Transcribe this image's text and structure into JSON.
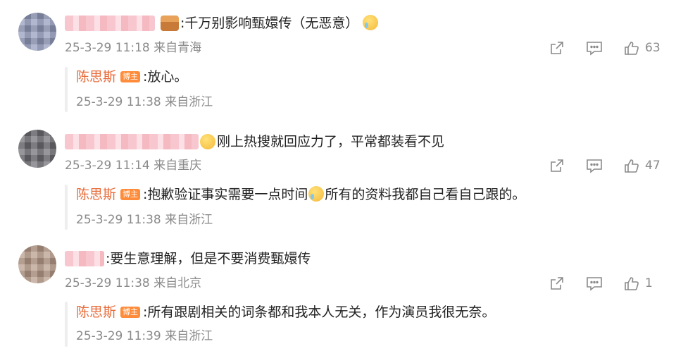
{
  "comments": [
    {
      "text": ":千万别影响甄嬛传（无恶意）",
      "time": "25-3-29 11:18 来自青海",
      "likes": "63",
      "reply": {
        "name": "陈思斯",
        "badge": "博主",
        "text": ":放心。",
        "time": "25-3-29 11:38 来自浙江"
      }
    },
    {
      "text": "刚上热搜就回应力了，平常都装看不见",
      "time": "25-3-29 11:14 来自重庆",
      "likes": "47",
      "reply": {
        "name": "陈思斯",
        "badge": "博主",
        "text_a": ":抱歉验证事实需要一点时间",
        "text_b": "所有的资料我都自己看自己跟的。",
        "time": "25-3-29 11:38 来自浙江"
      }
    },
    {
      "text": ":要生意理解，但是不要消费甄嬛传",
      "time": "25-3-29 11:38 来自北京",
      "likes": "1",
      "reply": {
        "name": "陈思斯",
        "badge": "博主",
        "text": ":所有跟剧相关的词条都和我本人无关，作为演员我很无奈。",
        "time": "25-3-29 11:39 来自浙江"
      }
    }
  ],
  "icons": {
    "share": "share-icon",
    "comment": "comment-icon",
    "like": "thumbs-up-icon"
  },
  "colors": {
    "reply_name": "#e86b3a",
    "badge_bg": "#ff8c3a",
    "meta": "#8a8a8a",
    "blurred_name": "#f7c0c8"
  }
}
